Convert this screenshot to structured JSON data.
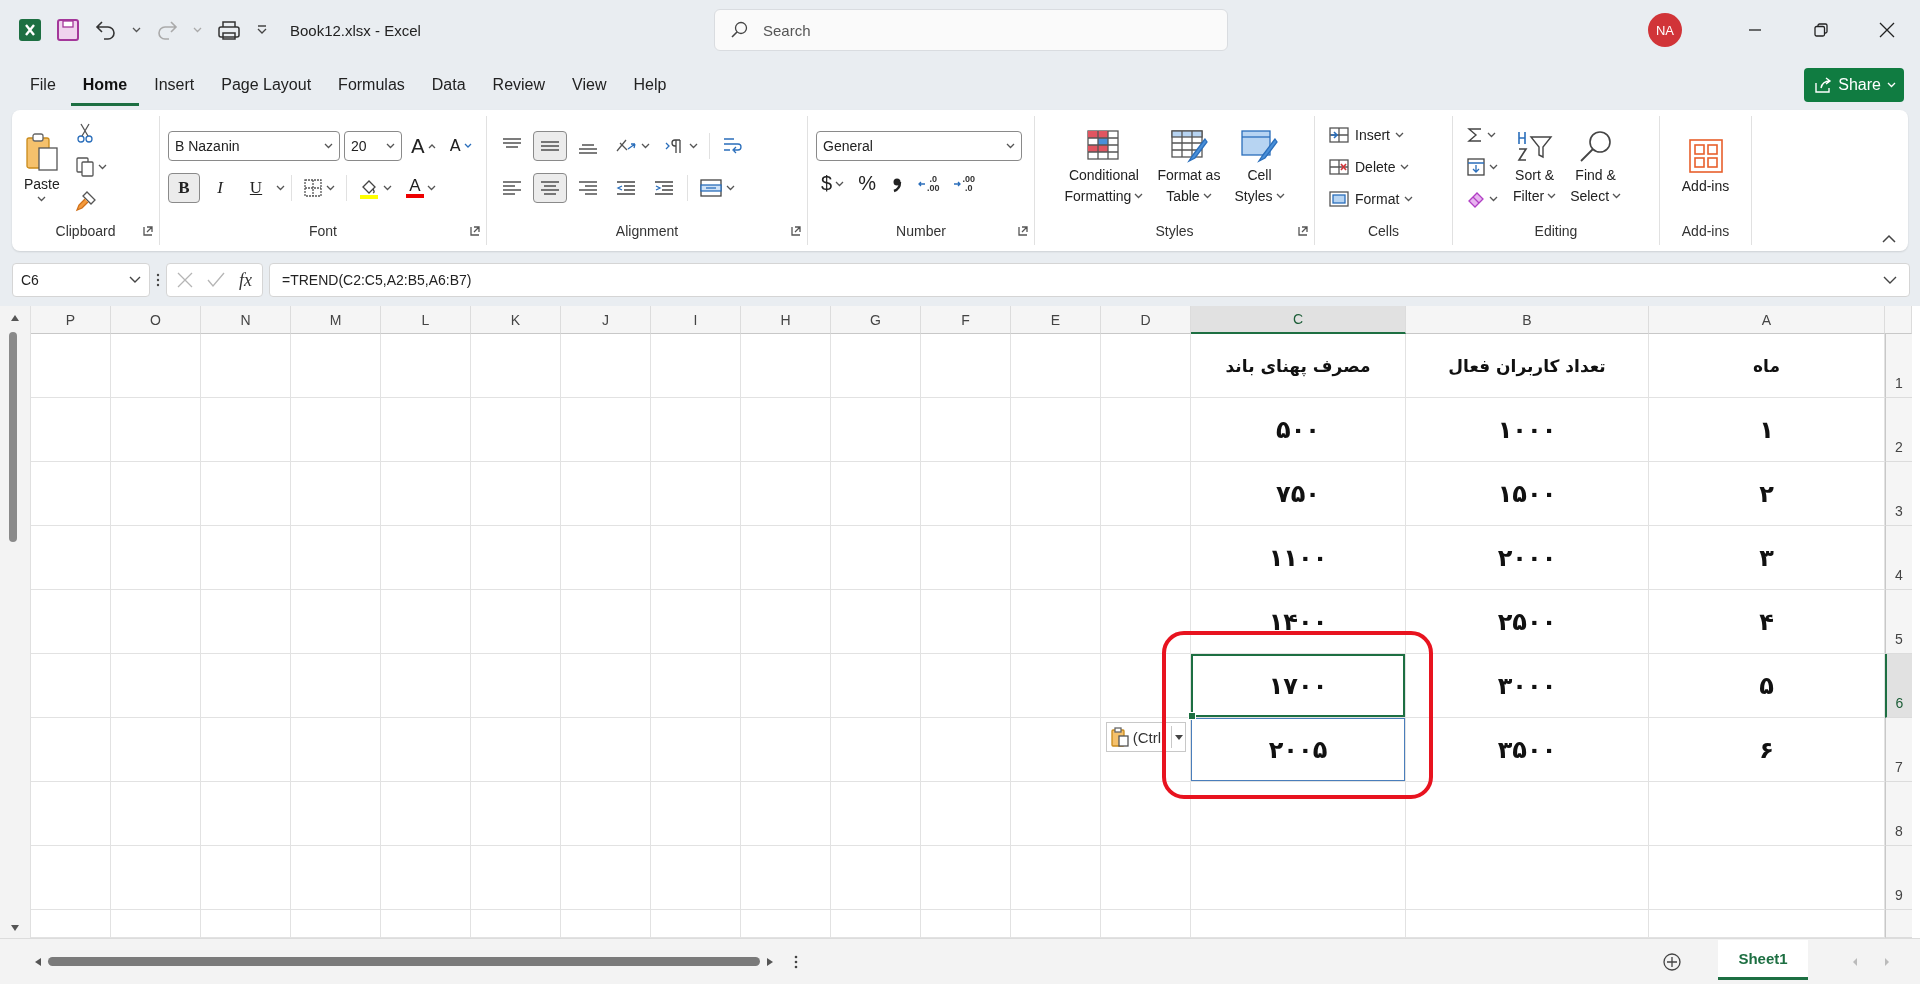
{
  "title_bar": {
    "file_name": "Book12.xlsx  -  Excel",
    "search": {
      "placeholder": "Search"
    },
    "avatar": "NA"
  },
  "menu": {
    "tabs": [
      {
        "label": "File",
        "selected": false
      },
      {
        "label": "Home",
        "selected": true
      },
      {
        "label": "Insert",
        "selected": false
      },
      {
        "label": "Page Layout",
        "selected": false
      },
      {
        "label": "Formulas",
        "selected": false
      },
      {
        "label": "Data",
        "selected": false
      },
      {
        "label": "Review",
        "selected": false
      },
      {
        "label": "View",
        "selected": false
      },
      {
        "label": "Help",
        "selected": false
      }
    ],
    "share": "Share"
  },
  "ribbon": {
    "clipboard": {
      "label": "Clipboard",
      "paste": "Paste"
    },
    "font": {
      "label": "Font",
      "font_name": "B Nazanin",
      "font_size": "20",
      "grow": "A",
      "shrink": "A",
      "bold": {
        "text": "B",
        "on": true
      },
      "italic": {
        "text": "I",
        "on": false
      },
      "underline": {
        "text": "U",
        "on": false
      },
      "font_color": "A"
    },
    "alignment": {
      "label": "Alignment",
      "vertical": [
        {
          "selected": false
        },
        {
          "selected": true
        },
        {
          "selected": false
        }
      ],
      "horizontal": [
        {
          "selected": false
        },
        {
          "selected": true
        },
        {
          "selected": false
        }
      ]
    },
    "number": {
      "label": "Number",
      "format": "General",
      "currency": "$",
      "percent": "%",
      "increase_decimal": [
        ".0",
        ".00"
      ],
      "decrease_decimal": [
        ".00",
        ".0"
      ]
    },
    "styles": {
      "label": "Styles",
      "buttons": [
        {
          "lines": [
            "Conditional",
            "Formatting"
          ],
          "kind": "conditional"
        },
        {
          "lines": [
            "Format as",
            "Table"
          ],
          "kind": "table"
        },
        {
          "lines": [
            "Cell",
            "Styles"
          ],
          "kind": "cellstyles"
        }
      ]
    },
    "cells": {
      "label": "Cells",
      "buttons": [
        {
          "label": "Insert",
          "kind": "insert"
        },
        {
          "label": "Delete",
          "kind": "delete"
        },
        {
          "label": "Format",
          "kind": "format"
        }
      ]
    },
    "editing": {
      "label": "Editing",
      "sort": [
        "Sort &",
        "Filter"
      ],
      "find": [
        "Find &",
        "Select"
      ]
    },
    "addins": {
      "label": "Add-ins",
      "button": "Add-ins"
    }
  },
  "formula_bar": {
    "name_box": "C6",
    "function_label": "fx",
    "formula": "=TREND(C2:C5,A2:B5,A6:B7)"
  },
  "sheet": {
    "columns": [
      {
        "label": "P",
        "selected": false
      },
      {
        "label": "O",
        "selected": false
      },
      {
        "label": "N",
        "selected": false
      },
      {
        "label": "M",
        "selected": false
      },
      {
        "label": "L",
        "selected": false
      },
      {
        "label": "K",
        "selected": false
      },
      {
        "label": "J",
        "selected": false
      },
      {
        "label": "I",
        "selected": false
      },
      {
        "label": "H",
        "selected": false
      },
      {
        "label": "G",
        "selected": false
      },
      {
        "label": "F",
        "selected": false
      },
      {
        "label": "E",
        "selected": false
      },
      {
        "label": "D",
        "selected": false
      },
      {
        "label": "C",
        "selected": true,
        "cells": [
          {
            "text": "مصرف پهنای باند",
            "active": false,
            "in_range": false
          },
          {
            "text": "۵۰۰",
            "active": false,
            "in_range": false
          },
          {
            "text": "۷۵۰",
            "active": false,
            "in_range": false
          },
          {
            "text": "۱۱۰۰",
            "active": false,
            "in_range": false
          },
          {
            "text": "۱۴۰۰",
            "active": false,
            "in_range": false
          },
          {
            "text": "۱۷۰۰",
            "active": true,
            "in_range": false
          },
          {
            "text": "۲۰۰۵",
            "active": false,
            "in_range": true
          }
        ]
      },
      {
        "label": "B",
        "selected": false,
        "cells": [
          {
            "text": "تعداد کاربران فعال",
            "active": false,
            "in_range": false
          },
          {
            "text": "۱۰۰۰",
            "active": false,
            "in_range": false
          },
          {
            "text": "۱۵۰۰",
            "active": false,
            "in_range": false
          },
          {
            "text": "۲۰۰۰",
            "active": false,
            "in_range": false
          },
          {
            "text": "۲۵۰۰",
            "active": false,
            "in_range": false
          },
          {
            "text": "۳۰۰۰",
            "active": false,
            "in_range": false
          },
          {
            "text": "۳۵۰۰",
            "active": false,
            "in_range": false
          }
        ]
      },
      {
        "label": "A",
        "selected": false,
        "cells": [
          {
            "text": "ماه",
            "active": false,
            "in_range": false
          },
          {
            "text": "۱",
            "active": false,
            "in_range": false
          },
          {
            "text": "۲",
            "active": false,
            "in_range": false
          },
          {
            "text": "۳",
            "active": false,
            "in_range": false
          },
          {
            "text": "۴",
            "active": false,
            "in_range": false
          },
          {
            "text": "۵",
            "active": false,
            "in_range": false
          },
          {
            "text": "۶",
            "active": false,
            "in_range": false
          }
        ]
      }
    ],
    "rows": [
      {
        "number": "1",
        "selected": false
      },
      {
        "number": "2",
        "selected": false
      },
      {
        "number": "3",
        "selected": false
      },
      {
        "number": "4",
        "selected": false
      },
      {
        "number": "5",
        "selected": false
      },
      {
        "number": "6",
        "selected": true
      },
      {
        "number": "7",
        "selected": false
      },
      {
        "number": "8",
        "selected": false
      },
      {
        "number": "9",
        "selected": false
      }
    ]
  },
  "paste_options": {
    "label": "(Ctrl"
  },
  "annotation": {
    "kind": "rounded-outline"
  },
  "sheet_tabs": [
    {
      "label": "Sheet1",
      "selected": true
    }
  ]
}
